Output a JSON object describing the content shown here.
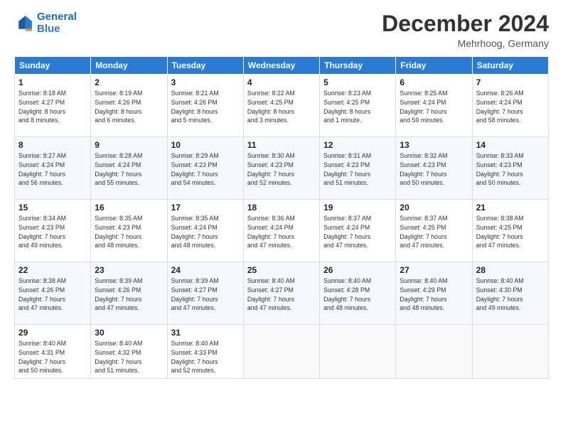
{
  "header": {
    "logo_line1": "General",
    "logo_line2": "Blue",
    "month": "December 2024",
    "location": "Mehrhoog, Germany"
  },
  "days_of_week": [
    "Sunday",
    "Monday",
    "Tuesday",
    "Wednesday",
    "Thursday",
    "Friday",
    "Saturday"
  ],
  "weeks": [
    [
      {
        "day": 1,
        "info": "Sunrise: 8:18 AM\nSunset: 4:27 PM\nDaylight: 8 hours\nand 8 minutes."
      },
      {
        "day": 2,
        "info": "Sunrise: 8:19 AM\nSunset: 4:26 PM\nDaylight: 8 hours\nand 6 minutes."
      },
      {
        "day": 3,
        "info": "Sunrise: 8:21 AM\nSunset: 4:26 PM\nDaylight: 8 hours\nand 5 minutes."
      },
      {
        "day": 4,
        "info": "Sunrise: 8:22 AM\nSunset: 4:25 PM\nDaylight: 8 hours\nand 3 minutes."
      },
      {
        "day": 5,
        "info": "Sunrise: 8:23 AM\nSunset: 4:25 PM\nDaylight: 8 hours\nand 1 minute."
      },
      {
        "day": 6,
        "info": "Sunrise: 8:25 AM\nSunset: 4:24 PM\nDaylight: 7 hours\nand 59 minutes."
      },
      {
        "day": 7,
        "info": "Sunrise: 8:26 AM\nSunset: 4:24 PM\nDaylight: 7 hours\nand 58 minutes."
      }
    ],
    [
      {
        "day": 8,
        "info": "Sunrise: 8:27 AM\nSunset: 4:24 PM\nDaylight: 7 hours\nand 56 minutes."
      },
      {
        "day": 9,
        "info": "Sunrise: 8:28 AM\nSunset: 4:24 PM\nDaylight: 7 hours\nand 55 minutes."
      },
      {
        "day": 10,
        "info": "Sunrise: 8:29 AM\nSunset: 4:23 PM\nDaylight: 7 hours\nand 54 minutes."
      },
      {
        "day": 11,
        "info": "Sunrise: 8:30 AM\nSunset: 4:23 PM\nDaylight: 7 hours\nand 52 minutes."
      },
      {
        "day": 12,
        "info": "Sunrise: 8:31 AM\nSunset: 4:23 PM\nDaylight: 7 hours\nand 51 minutes."
      },
      {
        "day": 13,
        "info": "Sunrise: 8:32 AM\nSunset: 4:23 PM\nDaylight: 7 hours\nand 50 minutes."
      },
      {
        "day": 14,
        "info": "Sunrise: 8:33 AM\nSunset: 4:23 PM\nDaylight: 7 hours\nand 50 minutes."
      }
    ],
    [
      {
        "day": 15,
        "info": "Sunrise: 8:34 AM\nSunset: 4:23 PM\nDaylight: 7 hours\nand 49 minutes."
      },
      {
        "day": 16,
        "info": "Sunrise: 8:35 AM\nSunset: 4:23 PM\nDaylight: 7 hours\nand 48 minutes."
      },
      {
        "day": 17,
        "info": "Sunrise: 8:35 AM\nSunset: 4:24 PM\nDaylight: 7 hours\nand 48 minutes."
      },
      {
        "day": 18,
        "info": "Sunrise: 8:36 AM\nSunset: 4:24 PM\nDaylight: 7 hours\nand 47 minutes."
      },
      {
        "day": 19,
        "info": "Sunrise: 8:37 AM\nSunset: 4:24 PM\nDaylight: 7 hours\nand 47 minutes."
      },
      {
        "day": 20,
        "info": "Sunrise: 8:37 AM\nSunset: 4:25 PM\nDaylight: 7 hours\nand 47 minutes."
      },
      {
        "day": 21,
        "info": "Sunrise: 8:38 AM\nSunset: 4:25 PM\nDaylight: 7 hours\nand 47 minutes."
      }
    ],
    [
      {
        "day": 22,
        "info": "Sunrise: 8:38 AM\nSunset: 4:26 PM\nDaylight: 7 hours\nand 47 minutes."
      },
      {
        "day": 23,
        "info": "Sunrise: 8:39 AM\nSunset: 4:26 PM\nDaylight: 7 hours\nand 47 minutes."
      },
      {
        "day": 24,
        "info": "Sunrise: 8:39 AM\nSunset: 4:27 PM\nDaylight: 7 hours\nand 47 minutes."
      },
      {
        "day": 25,
        "info": "Sunrise: 8:40 AM\nSunset: 4:27 PM\nDaylight: 7 hours\nand 47 minutes."
      },
      {
        "day": 26,
        "info": "Sunrise: 8:40 AM\nSunset: 4:28 PM\nDaylight: 7 hours\nand 48 minutes."
      },
      {
        "day": 27,
        "info": "Sunrise: 8:40 AM\nSunset: 4:29 PM\nDaylight: 7 hours\nand 48 minutes."
      },
      {
        "day": 28,
        "info": "Sunrise: 8:40 AM\nSunset: 4:30 PM\nDaylight: 7 hours\nand 49 minutes."
      }
    ],
    [
      {
        "day": 29,
        "info": "Sunrise: 8:40 AM\nSunset: 4:31 PM\nDaylight: 7 hours\nand 50 minutes."
      },
      {
        "day": 30,
        "info": "Sunrise: 8:40 AM\nSunset: 4:32 PM\nDaylight: 7 hours\nand 51 minutes."
      },
      {
        "day": 31,
        "info": "Sunrise: 8:40 AM\nSunset: 4:33 PM\nDaylight: 7 hours\nand 52 minutes."
      },
      null,
      null,
      null,
      null
    ]
  ]
}
